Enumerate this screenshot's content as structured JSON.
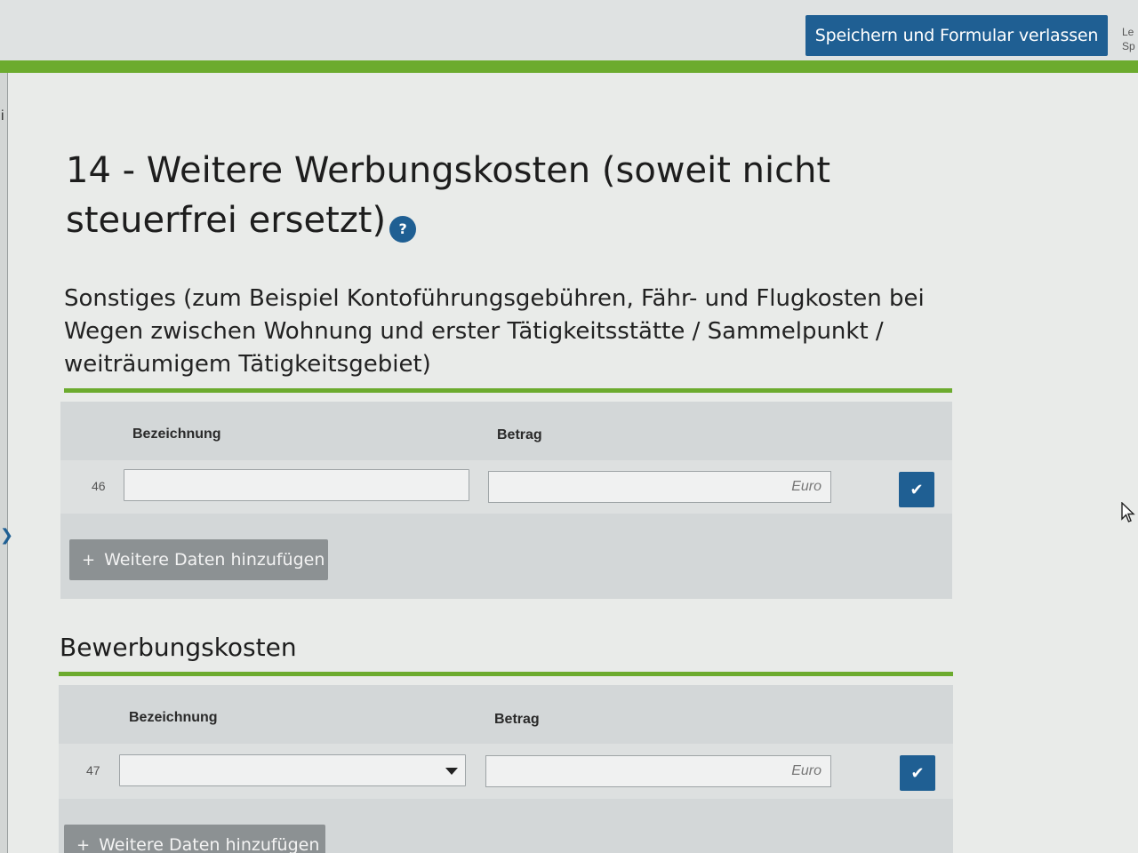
{
  "header": {
    "save_button": "Speichern und Formular verlassen",
    "side_text_1": "Le",
    "side_text_2": "Sp"
  },
  "section": {
    "title": "14 - Weitere Werbungskosten (soweit nicht steuerfrei ersetzt)",
    "help_icon": "?"
  },
  "sonstiges": {
    "heading": "Sonstiges (zum Beispiel Kontoführungsgebühren, Fähr- und Flugkosten bei Wegen zwischen Wohnung und erster Tätigkeitsstätte / Sammelpunkt / weiträumigem Tätigkeitsgebiet)",
    "col_designation": "Bezeichnung",
    "col_amount": "Betrag",
    "row_number": "46",
    "designation_value": "",
    "amount_value": "",
    "amount_unit": "Euro",
    "add_button": "Weitere Daten hinzufügen"
  },
  "bewerbungskosten": {
    "heading": "Bewerbungskosten",
    "col_designation": "Bezeichnung",
    "col_amount": "Betrag",
    "row_number": "47",
    "designation_value": "",
    "amount_value": "",
    "amount_unit": "Euro",
    "add_button": "Weitere Daten hinzufügen"
  },
  "icons": {
    "check": "check-icon",
    "plus": "plus-icon",
    "dropdown": "chevron-down-icon",
    "help": "question-icon",
    "cursor": "mouse-pointer-icon"
  },
  "colors": {
    "accent_blue": "#1f5f93",
    "accent_green": "#6cab2e",
    "button_gray": "#8c9193"
  }
}
